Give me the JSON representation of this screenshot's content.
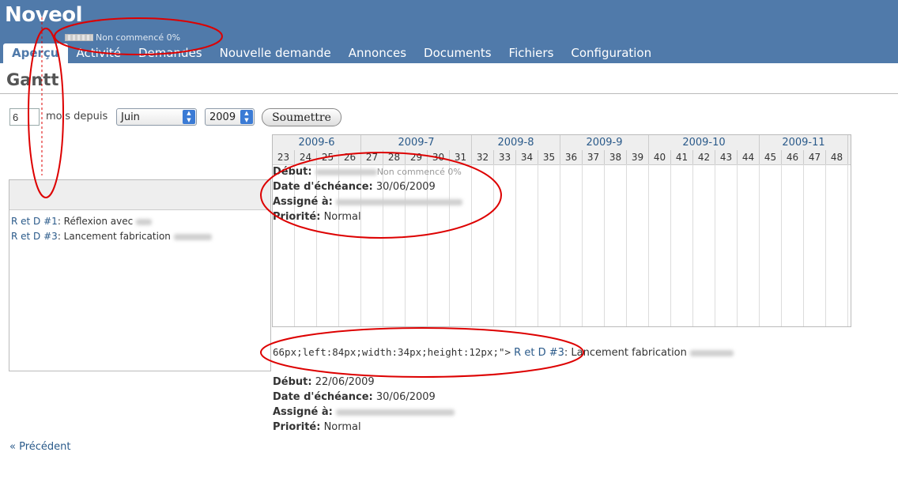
{
  "header": {
    "app_title": "Noveol",
    "progress_text": "Non commencé 0%",
    "menu": [
      {
        "label": "Aperçu",
        "selected": true
      },
      {
        "label": "Activité"
      },
      {
        "label": "Demandes"
      },
      {
        "label": "Nouvelle demande"
      },
      {
        "label": "Annonces"
      },
      {
        "label": "Documents"
      },
      {
        "label": "Fichiers"
      },
      {
        "label": "Configuration"
      }
    ]
  },
  "page": {
    "title": "Gantt",
    "months_value": "6",
    "months_label": "mois depuis",
    "month_select": "Juin",
    "year_select": "2009",
    "submit_label": "Soumettre",
    "prev_link": "« Précédent"
  },
  "issues": [
    {
      "id": "R et D #1",
      "subject": ": Réflexion avec"
    },
    {
      "id": "R et D #3",
      "subject": ": Lancement fabrication"
    }
  ],
  "gantt": {
    "months": [
      "2009-6",
      "2009-7",
      "2009-8",
      "2009-9",
      "2009-10",
      "2009-11"
    ],
    "weeks": [
      "23",
      "24",
      "25",
      "26",
      "27",
      "28",
      "29",
      "30",
      "31",
      "32",
      "33",
      "34",
      "35",
      "36",
      "37",
      "38",
      "39",
      "40",
      "41",
      "42",
      "43",
      "44",
      "45",
      "46",
      "47",
      "48"
    ]
  },
  "tooltip1": {
    "start_label": "Début:",
    "overlay_text": "Non commencé 0%",
    "due_label": "Date d'échéance:",
    "due_value": "30/06/2009",
    "assignee_label": "Assigné à:",
    "priority_label": "Priorité:",
    "priority_value": "Normal"
  },
  "broken_line": {
    "code": "66px;left:84px;width:34px;height:12px;\">",
    "issue_id": "R et D #3",
    "subject": ": Lancement fabrication"
  },
  "tooltip2": {
    "start_label": "Début:",
    "start_value": "22/06/2009",
    "due_label": "Date d'échéance:",
    "due_value": "30/06/2009",
    "assignee_label": "Assigné à:",
    "priority_label": "Priorité:",
    "priority_value": "Normal"
  },
  "colors": {
    "header_bg": "#507aaa",
    "link": "#2a5a8a",
    "annotation": "#dd0000"
  }
}
